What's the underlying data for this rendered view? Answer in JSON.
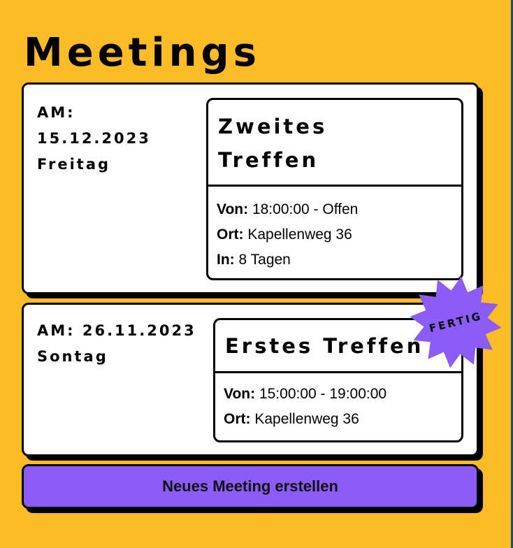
{
  "page": {
    "title": "Meetings"
  },
  "meetings": [
    {
      "date_lines": [
        "AM:",
        "15.12.2023",
        "Freitag"
      ],
      "title_lines": [
        "Zweites",
        "Treffen"
      ],
      "details": [
        {
          "key": "Von:",
          "value": "18:00:00 - Offen"
        },
        {
          "key": "Ort:",
          "value": "Kapellenweg 36"
        },
        {
          "key": "In:",
          "value": "8 Tagen"
        }
      ]
    },
    {
      "date_lines": [
        "AM: 26.11.2023",
        "Sontag"
      ],
      "title": "Erstes Treffen",
      "badge": "FERTIG",
      "details": [
        {
          "key": "Von:",
          "value": "15:00:00 - 19:00:00"
        },
        {
          "key": "Ort:",
          "value": "Kapellenweg 36"
        }
      ]
    }
  ],
  "actions": {
    "create_label": "Neues Meeting erstellen"
  },
  "colors": {
    "background": "#fcbc25",
    "accent": "#8b5cf6",
    "card": "#ffffff",
    "border": "#000000"
  }
}
